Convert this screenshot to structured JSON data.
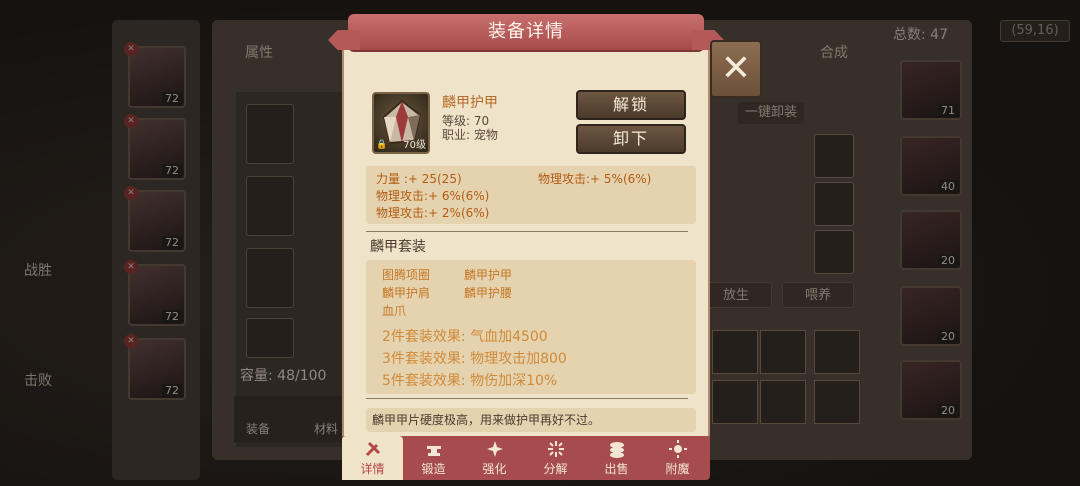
{
  "background": {
    "tab_attr": "属性",
    "tab_compose": "合成",
    "total_label": "总数: 47",
    "coords": "(59,16)",
    "capacity": "容量: 48/100",
    "one_click_unequip": "一键卸装",
    "hero_levels": [
      "72",
      "72",
      "72",
      "72",
      "72"
    ],
    "right_levels": [
      "71",
      "40",
      "20",
      "20",
      "20"
    ],
    "btn_release": "放生",
    "btn_feed": "喂养",
    "bottom_tab_equip": "装备",
    "bottom_tab_material": "材料",
    "left_text": [
      "战胜",
      "击败"
    ]
  },
  "modal": {
    "title": "装备详情",
    "item": {
      "name": "麟甲护甲",
      "level_line": "等级:  70",
      "job_line": "职业:  宠物",
      "icon_level": "70级",
      "icon_name": "diamond-armor-icon"
    },
    "buttons": {
      "unlock": "解锁",
      "unequip": "卸下"
    },
    "stats": [
      "力量       :+ 25(25)",
      "物理攻击:+ 5%(6%)",
      "物理攻击:+ 6%(6%)",
      "物理攻击:+ 2%(6%)"
    ],
    "set": {
      "title": "麟甲套装",
      "pieces": [
        "图腾项圈",
        "麟甲护甲",
        "麟甲护肩",
        "麟甲护腰",
        "血爪"
      ],
      "effects": [
        "2件套装效果:  气血加4500",
        "3件套装效果:  物理攻击加800",
        "5件套装效果:  物伤加深10%"
      ]
    },
    "description": "麟甲甲片硬度极高，用来做护甲再好不过。",
    "tabs": [
      "详情",
      "锻造",
      "强化",
      "分解",
      "出售",
      "附魔"
    ],
    "active_tab": "详情"
  },
  "colors": {
    "ribbon": "#a84a4b",
    "panel": "#efe3c9",
    "stat_text": "#b25b12",
    "set_effect": "#d08a38"
  }
}
